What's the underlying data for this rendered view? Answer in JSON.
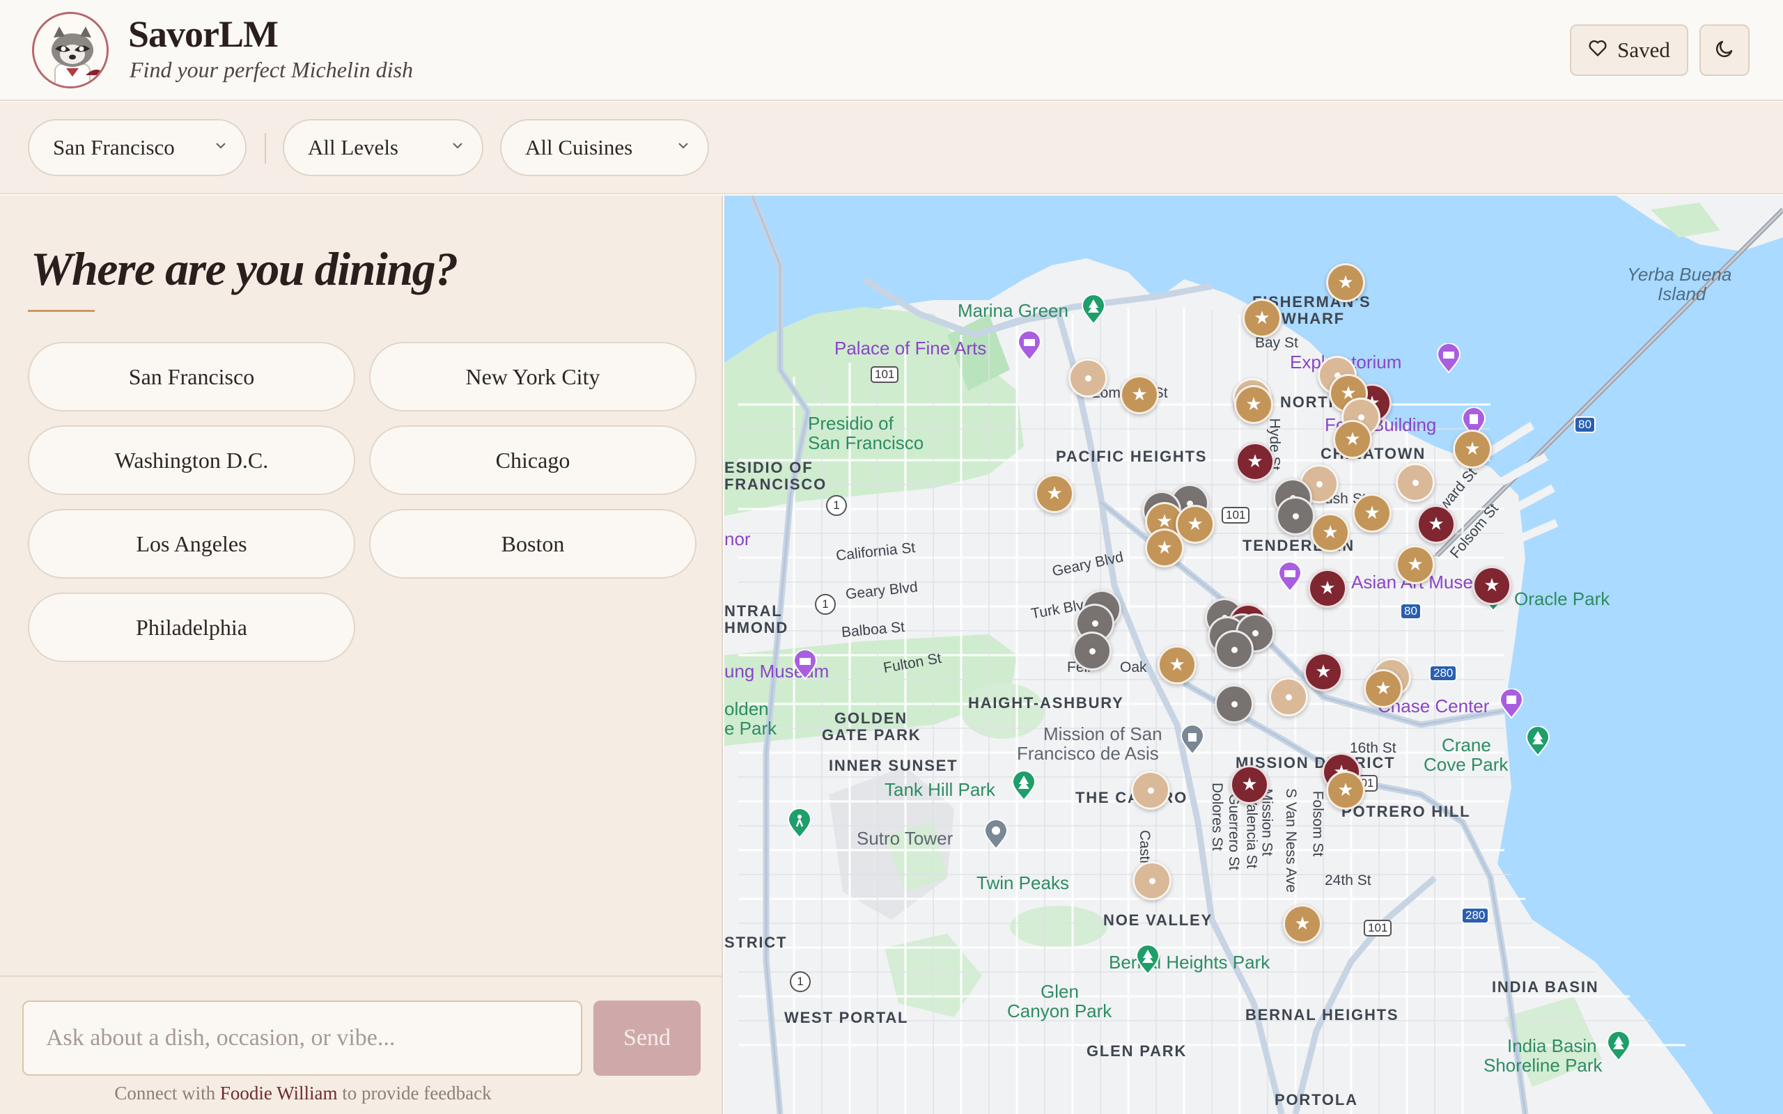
{
  "header": {
    "title": "SavorLM",
    "tagline": "Find your perfect Michelin dish",
    "saved_label": "Saved",
    "logo_icon": "raccoon-chef-logo",
    "theme_icon": "moon-icon"
  },
  "filters": {
    "city": "San Francisco",
    "level": "All Levels",
    "cuisine": "All Cuisines"
  },
  "panel": {
    "heading": "Where are you dining?",
    "cities": [
      "San Francisco",
      "New York City",
      "Washington D.C.",
      "Chicago",
      "Los Angeles",
      "Boston",
      "Philadelphia"
    ]
  },
  "chat": {
    "placeholder": "Ask about a dish, occasion, or vibe...",
    "send_label": "Send",
    "feedback_prefix": "Connect with",
    "feedback_link": "Foodie William",
    "feedback_suffix": "to provide feedback"
  },
  "map": {
    "labels": {
      "marina_green": "Marina Green",
      "palace": "Palace of Fine Arts",
      "presidio1": "Presidio of",
      "presidio2": "San Francisco",
      "esidio1": "ESIDIO OF",
      "esidio2": "FRANCISCO",
      "fishermans1": "FISHERMAN'S",
      "fishermans2": "WHARF",
      "bay_st": "Bay St",
      "exploratorium": "Exploratorium",
      "north": "NORTH",
      "lombard": "Lombard St",
      "ferry": "Ferry Building",
      "pacific_heights": "PACIFIC HEIGHTS",
      "hyde": "Hyde St",
      "chinatown": "CHINATOWN",
      "bush": "Bush St",
      "howard": "Howard St",
      "folsom": "Folsom St",
      "tenderloin": "TENDERLOIN",
      "california": "California St",
      "geary_blvd1": "Geary Blvd",
      "geary_blvd2": "Geary Blvd",
      "turk": "Turk Blvd",
      "balboa": "Balboa St",
      "fulton": "Fulton St",
      "asian_art": "Asian Art Museum",
      "oracle": "Oracle Park",
      "ntral1": "NTRAL",
      "ntral2": "HMOND",
      "nor": "nor",
      "ung_museum": "ung Museum",
      "golden_park1": "olden",
      "golden_park2": "e Park",
      "golden_gate1": "GOLDEN",
      "golden_gate2": "GATE PARK",
      "haight": "HAIGHT-ASHBURY",
      "oak": "Oak",
      "fell": "Fell",
      "chase": "Chase Center",
      "crane1": "Crane",
      "crane2": "Cove Park",
      "mission_dolores1": "Mission of San",
      "mission_dolores2": "Francisco de Asis",
      "inner_sunset": "INNER SUNSET",
      "tank_hill": "Tank Hill Park",
      "the_castro": "THE CASTRO",
      "mission_district": "MISSION DISTRICT",
      "16th": "16th St",
      "potrero": "POTRERO HILL",
      "sutro": "Sutro Tower",
      "twin_peaks": "Twin Peaks",
      "dolores_st": "Dolores St",
      "guerrero": "Guerrero St",
      "valencia": "Valencia St",
      "mission_st": "Mission St",
      "van_ness": "S Van Ness Ave",
      "folsom2": "Folsom St",
      "castro": "Castro",
      "24th": "24th St",
      "noe": "NOE VALLEY",
      "strict": "STRICT",
      "bernal_park": "Bernal Heights Park",
      "glen1": "Glen",
      "glen2": "Canyon Park",
      "west_portal": "WEST PORTAL",
      "bernal": "BERNAL HEIGHTS",
      "india_basin": "INDIA BASIN",
      "india_park1": "India Basin",
      "india_park2": "Shoreline Park",
      "glen_park": "GLEN PARK",
      "portola": "PORTOLA",
      "yerba1": "Yerba Buena",
      "yerba2": "Island",
      "hwy_101a": "101",
      "hwy_101b": "101",
      "hwy_101c": "101",
      "hwy_101d": "101",
      "hwy_1a": "1",
      "hwy_1b": "1",
      "hwy_1c": "1",
      "hwy_80a": "80",
      "hwy_80b": "80",
      "hwy_280a": "280",
      "hwy_280b": "280"
    }
  }
}
